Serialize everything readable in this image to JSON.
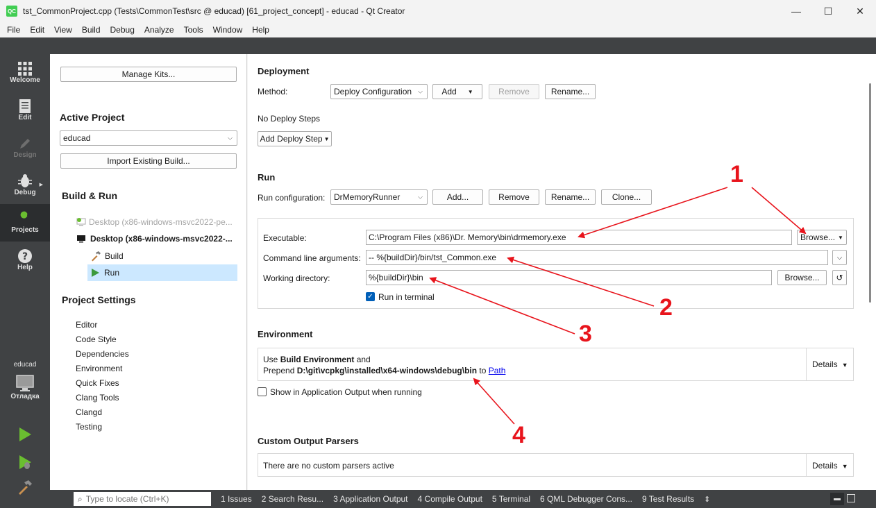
{
  "window": {
    "title": "tst_CommonProject.cpp (Tests\\CommonTest\\src @ educad) [61_project_concept] - educad - Qt Creator",
    "app_icon": "QC",
    "minimize": "—",
    "maximize": "☐",
    "close": "✕"
  },
  "menu": [
    "File",
    "Edit",
    "View",
    "Build",
    "Debug",
    "Analyze",
    "Tools",
    "Window",
    "Help"
  ],
  "modes": [
    {
      "label": "Welcome",
      "icon": "grid-icon"
    },
    {
      "label": "Edit",
      "icon": "document-icon"
    },
    {
      "label": "Design",
      "icon": "pencil-icon"
    },
    {
      "label": "Debug",
      "icon": "bug-icon"
    },
    {
      "label": "Projects",
      "icon": "wrench-icon"
    },
    {
      "label": "Help",
      "icon": "help-icon"
    }
  ],
  "kit_selector": {
    "project": "educad",
    "build": "Отладка"
  },
  "left": {
    "manage_kits": "Manage Kits...",
    "active_project_heading": "Active Project",
    "active_project_value": "educad",
    "import_build": "Import Existing Build...",
    "build_run_heading": "Build & Run",
    "kit_inactive": "Desktop (x86-windows-msvc2022-pe...",
    "kit_active": "Desktop (x86-windows-msvc2022-...",
    "build_item": "Build",
    "run_item": "Run",
    "project_settings_heading": "Project Settings",
    "settings": [
      "Editor",
      "Code Style",
      "Dependencies",
      "Environment",
      "Quick Fixes",
      "Clang Tools",
      "Clangd",
      "Testing"
    ]
  },
  "deployment": {
    "heading": "Deployment",
    "method_label": "Method:",
    "method_value": "Deploy Configuration",
    "add": "Add",
    "remove": "Remove",
    "rename": "Rename...",
    "no_steps": "No Deploy Steps",
    "add_step": "Add Deploy Step"
  },
  "run": {
    "heading": "Run",
    "config_label": "Run configuration:",
    "config_value": "DrMemoryRunner",
    "add": "Add...",
    "remove": "Remove",
    "rename": "Rename...",
    "clone": "Clone...",
    "executable_label": "Executable:",
    "executable_value": "C:\\Program Files (x86)\\Dr. Memory\\bin\\drmemory.exe",
    "browse_menu": "Browse...",
    "args_label": "Command line arguments:",
    "args_value": "-- %{buildDir}/bin/tst_Common.exe",
    "workdir_label": "Working directory:",
    "workdir_value": "%{buildDir}\\bin",
    "browse": "Browse...",
    "run_in_terminal": "Run in terminal"
  },
  "environment": {
    "heading": "Environment",
    "line1_prefix": "Use ",
    "line1_bold": "Build Environment",
    "line1_suffix": " and",
    "line2_prefix": "Prepend ",
    "line2_bold": "D:\\git\\vcpkg\\installed\\x64-windows\\debug\\bin",
    "line2_mid": " to ",
    "line2_link": "Path",
    "details": "Details",
    "show_output": "Show in Application Output when running"
  },
  "parsers": {
    "heading": "Custom Output Parsers",
    "text": "There are no custom parsers active",
    "details": "Details"
  },
  "annotations": [
    "1",
    "2",
    "3",
    "4"
  ],
  "statusbar": {
    "locator_placeholder": "Type to locate (Ctrl+K)",
    "tabs": [
      "1  Issues",
      "2  Search Resu...",
      "3  Application Output",
      "4  Compile Output",
      "5  Terminal",
      "6  QML Debugger Cons...",
      "9  Test Results"
    ]
  }
}
